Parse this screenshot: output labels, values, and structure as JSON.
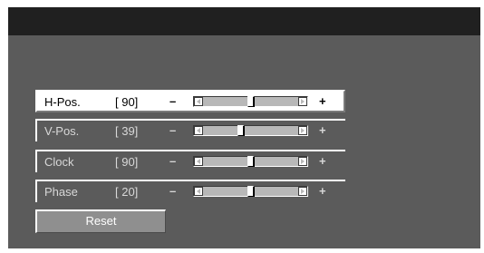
{
  "menu": {
    "rows": [
      {
        "label": "H-Pos.",
        "value": "[ 90]",
        "minus": "–",
        "plus": "+",
        "level": 0.5,
        "selected": true
      },
      {
        "label": "V-Pos.",
        "value": "[ 39]",
        "minus": "–",
        "plus": "+",
        "level": 0.39,
        "selected": false
      },
      {
        "label": "Clock",
        "value": "[ 90]",
        "minus": "–",
        "plus": "+",
        "level": 0.5,
        "selected": false
      },
      {
        "label": "Phase",
        "value": "[ 20]",
        "minus": "–",
        "plus": "+",
        "level": 0.5,
        "selected": false
      }
    ],
    "reset_label": "Reset"
  },
  "colors": {
    "screen_bg": "#5b5b5b",
    "title_bar": "#202020",
    "selected_row": "#ffffff",
    "reset_button": "#8f8f8f"
  },
  "icons": {
    "slider_left": "left-arrow-icon",
    "slider_right": "right-arrow-icon"
  }
}
